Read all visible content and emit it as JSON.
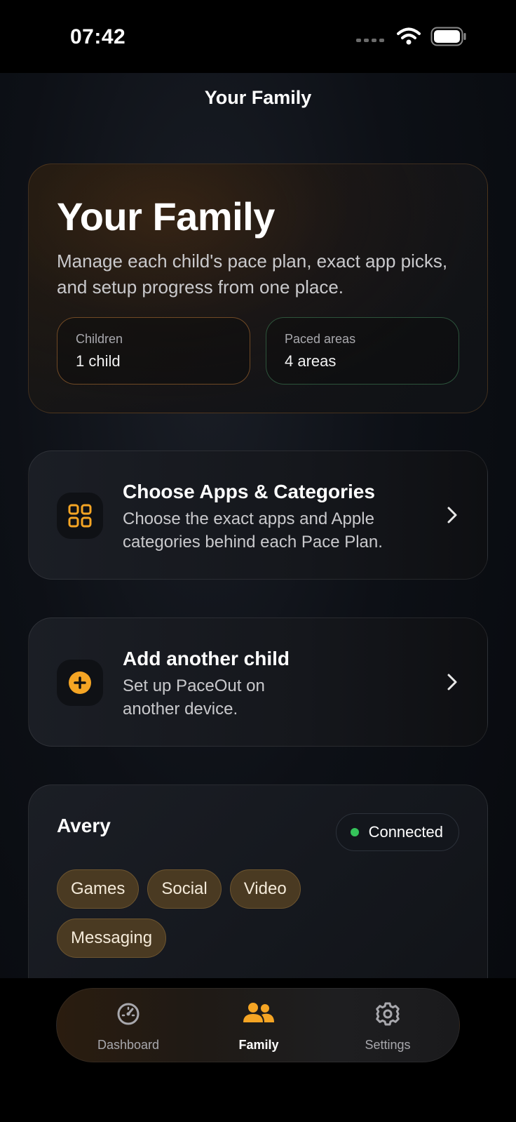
{
  "status_bar": {
    "time": "07:42"
  },
  "nav": {
    "title": "Your Family"
  },
  "hero": {
    "title": "Your Family",
    "description": "Manage each child's pace plan, exact app picks, and setup progress from one place.",
    "stats": [
      {
        "label": "Children",
        "value": "1 child"
      },
      {
        "label": "Paced areas",
        "value": "4 areas"
      }
    ]
  },
  "actions": [
    {
      "title": "Choose Apps & Categories",
      "description": "Choose the exact apps and Apple categories behind each Pace Plan.",
      "icon": "grid-icon"
    },
    {
      "title": "Add another child",
      "description": "Set up PaceOut on another device.",
      "icon": "plus-circle-icon"
    }
  ],
  "child": {
    "name": "Avery",
    "status": "Connected",
    "categories": [
      "Games",
      "Social",
      "Video",
      "Messaging"
    ]
  },
  "tabs": [
    {
      "label": "Dashboard",
      "icon": "speedometer-icon",
      "active": false
    },
    {
      "label": "Family",
      "icon": "people-icon",
      "active": true
    },
    {
      "label": "Settings",
      "icon": "gear-icon",
      "active": false
    }
  ],
  "colors": {
    "accent": "#F5A524",
    "connected": "#35C35A",
    "chip_bg": "#4A3A22"
  }
}
